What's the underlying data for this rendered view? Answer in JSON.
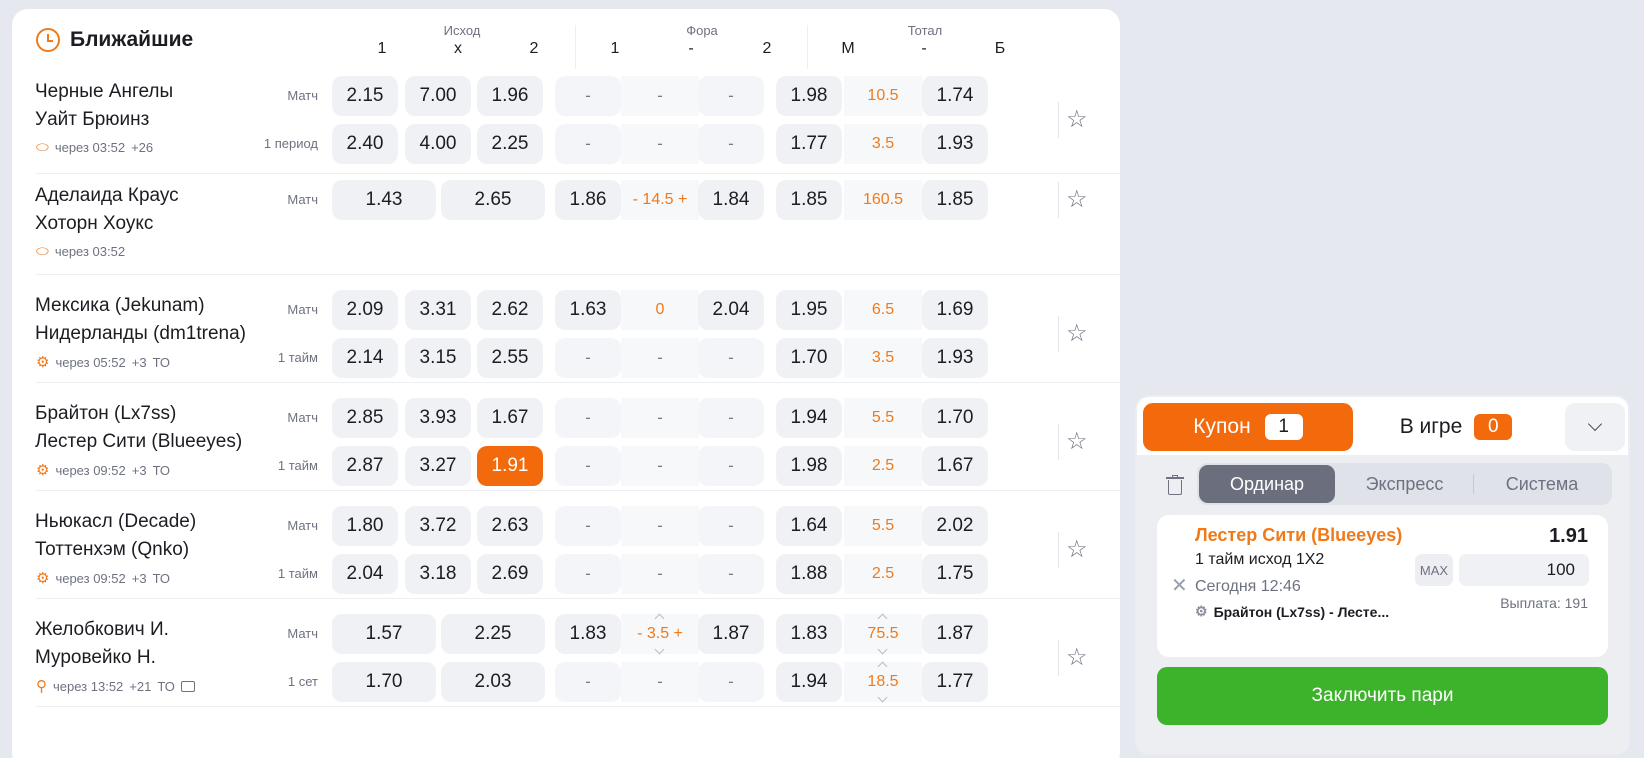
{
  "events_panel": {
    "title": "Ближайшие",
    "groups": {
      "outcome": "Исход",
      "handicap": "Фора",
      "total": "Тотал"
    },
    "columns": {
      "o1": "1",
      "ox": "х",
      "o2": "2",
      "h1": "1",
      "hmid": "-",
      "h2": "2",
      "tm": "М",
      "tmid": "-",
      "tb": "Б"
    }
  },
  "events": [
    {
      "team1": "Черные Ангелы",
      "team2": "Уайт Брюинз",
      "sport_icon": "rugby-ball-icon",
      "time": "через 03:52",
      "extra": "+26",
      "rows": [
        {
          "period": "Матч",
          "o1": "2.15",
          "ox": "7.00",
          "o2": "1.96",
          "h1": "-",
          "hv": "-",
          "h2": "-",
          "tm": "1.98",
          "tv": "10.5",
          "tb": "1.74"
        },
        {
          "period": "1 период",
          "o1": "2.40",
          "ox": "4.00",
          "o2": "2.25",
          "h1": "-",
          "hv": "-",
          "h2": "-",
          "tm": "1.77",
          "tv": "3.5",
          "tb": "1.93"
        }
      ]
    },
    {
      "team1": "Аделаида Краус",
      "team2": "Хоторн Хоукс",
      "sport_icon": "rugby-ball-icon",
      "time": "через 03:52",
      "rows": [
        {
          "period": "Матч",
          "o1": "1.43",
          "o2": "2.65",
          "h1": "1.86",
          "hv": "- 14.5 +",
          "h2": "1.84",
          "tm": "1.85",
          "tv": "160.5",
          "tb": "1.85"
        }
      ]
    },
    {
      "team1": "Мексика (Jekunam)",
      "team2": "Нидерланды (dm1trena)",
      "sport_icon": "esports-gamepad-icon",
      "time": "через 05:52",
      "extra": "+3",
      "tag": "ТО",
      "rows": [
        {
          "period": "Матч",
          "o1": "2.09",
          "ox": "3.31",
          "o2": "2.62",
          "h1": "1.63",
          "hv": "0",
          "h2": "2.04",
          "tm": "1.95",
          "tv": "6.5",
          "tb": "1.69"
        },
        {
          "period": "1 тайм",
          "o1": "2.14",
          "ox": "3.15",
          "o2": "2.55",
          "h1": "-",
          "hv": "-",
          "h2": "-",
          "tm": "1.70",
          "tv": "3.5",
          "tb": "1.93"
        }
      ]
    },
    {
      "team1": "Брайтон (Lx7ss)",
      "team2": "Лестер Сити (Blueeyes)",
      "sport_icon": "esports-gamepad-icon",
      "time": "через 09:52",
      "extra": "+3",
      "tag": "ТО",
      "rows": [
        {
          "period": "Матч",
          "o1": "2.85",
          "ox": "3.93",
          "o2": "1.67",
          "h1": "-",
          "hv": "-",
          "h2": "-",
          "tm": "1.94",
          "tv": "5.5",
          "tb": "1.70"
        },
        {
          "period": "1 тайм",
          "o1": "2.87",
          "ox": "3.27",
          "o2": "1.91",
          "h1": "-",
          "hv": "-",
          "h2": "-",
          "tm": "1.98",
          "tv": "2.5",
          "tb": "1.67"
        }
      ]
    },
    {
      "team1": "Ньюкасл (Decade)",
      "team2": "Тоттенхэм (Qnko)",
      "sport_icon": "esports-gamepad-icon",
      "time": "через 09:52",
      "extra": "+3",
      "tag": "ТО",
      "rows": [
        {
          "period": "Матч",
          "o1": "1.80",
          "ox": "3.72",
          "o2": "2.63",
          "h1": "-",
          "hv": "-",
          "h2": "-",
          "tm": "1.64",
          "tv": "5.5",
          "tb": "2.02"
        },
        {
          "period": "1 тайм",
          "o1": "2.04",
          "ox": "3.18",
          "o2": "2.69",
          "h1": "-",
          "hv": "-",
          "h2": "-",
          "tm": "1.88",
          "tv": "2.5",
          "tb": "1.75"
        }
      ]
    },
    {
      "team1": "Желобкович И.",
      "team2": "Муровейко Н.",
      "sport_icon": "tennis-racket-icon",
      "time": "через 13:52",
      "extra": "+21",
      "tag": "ТО",
      "rows": [
        {
          "period": "Матч",
          "o1": "1.57",
          "o2": "2.25",
          "h1": "1.83",
          "hv": "- 3.5 +",
          "h2": "1.87",
          "tm": "1.83",
          "tv": "75.5",
          "tb": "1.87"
        },
        {
          "period": "1 сет",
          "o1": "1.70",
          "o2": "2.03",
          "h1": "-",
          "hv": "-",
          "h2": "-",
          "tm": "1.94",
          "tv": "18.5",
          "tb": "1.77"
        }
      ]
    }
  ],
  "coupon": {
    "tab_coupon": "Купон",
    "coupon_count": "1",
    "tab_ingame": "В игре",
    "ingame_count": "0",
    "modes": {
      "single": "Ординар",
      "express": "Экспресс",
      "system": "Система"
    },
    "bet": {
      "team": "Лестер Сити (Blueeyes)",
      "odd": "1.91",
      "market": "1 тайм исход 1X2",
      "date": "Сегодня 12:46",
      "event": "Брайтон (Lx7ss) - Лесте...",
      "max_label": "MAX",
      "stake": "100",
      "payout": "Выплата: 191"
    },
    "place_button": "Заключить пари"
  },
  "colors": {
    "accent": "#f36a0c",
    "accent_text": "#f07a1a",
    "place_bet": "#3db32b"
  }
}
